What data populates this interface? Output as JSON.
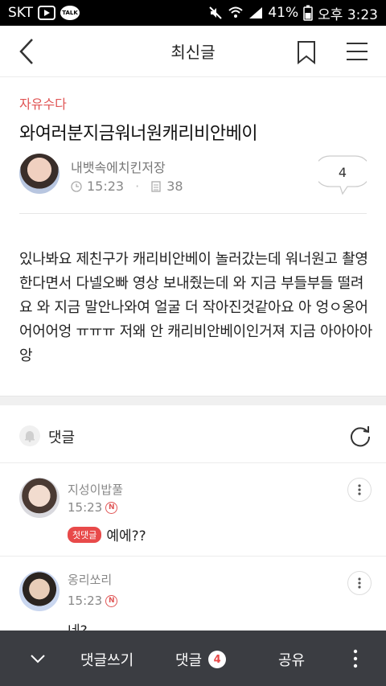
{
  "status_bar": {
    "carrier": "SKT",
    "talk_badge": "TALK",
    "battery": "41%",
    "time": "오후 3:23"
  },
  "header": {
    "title": "최신글"
  },
  "post": {
    "category": "자유수다",
    "title": "와여러분지금워너원캐리비안베이",
    "author": "내뱃속에치킨저장",
    "time": "15:23",
    "views": "38",
    "comment_count": "4",
    "body": "있나봐요 제친구가 캐리비안베이 놀러갔는데 워너원고 촬영 한다면서 다넬오빠 영상 보내줬는데 와 지금 부들부들 떨려요 와 지금 말안나와여 얼굴 더 작아진것같아요 아 엉ㅇ옹어어어어엉 ㅠㅠㅠ 저왜 안 캐리비안베이인거져 지금 아아아아앙"
  },
  "comments_section": {
    "label": "댓글",
    "items": [
      {
        "name": "지성이밥풀",
        "time": "15:23",
        "new_mark": "N",
        "first_badge": "첫댓글",
        "text": "예에??"
      },
      {
        "name": "옹리쏘리",
        "time": "15:23",
        "new_mark": "N",
        "text": "네?"
      }
    ]
  },
  "bottom_bar": {
    "write_label": "댓글쓰기",
    "comments_label": "댓글",
    "comments_count": "4",
    "share_label": "공유"
  },
  "colors": {
    "accent_red": "#e05555",
    "bottom_bar_bg": "#3b3d42"
  }
}
